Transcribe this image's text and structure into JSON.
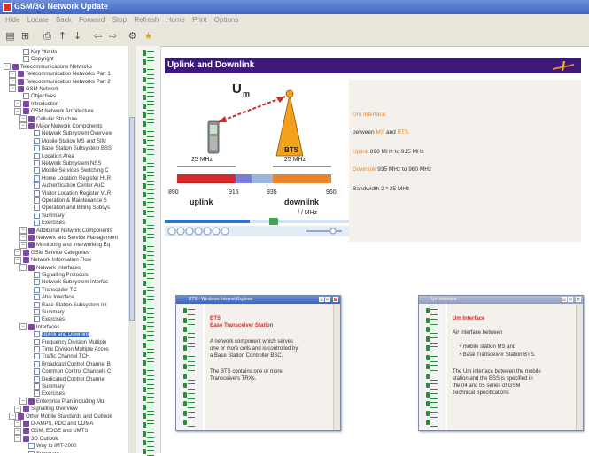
{
  "window": {
    "title": "GSM/3G Network Update"
  },
  "menubar": {
    "items": [
      "Hide",
      "Locate",
      "Back",
      "Forward",
      "Stop",
      "Refresh",
      "Home",
      "Print",
      "Options"
    ]
  },
  "tree": {
    "items": [
      {
        "label": "Key Words",
        "depth": 3,
        "icon": "page"
      },
      {
        "label": "Copyright",
        "depth": 3,
        "icon": "page"
      },
      {
        "label": "Telecommunications Networks",
        "depth": 1,
        "icon": "book"
      },
      {
        "label": "Telecommunication Networks Part 1",
        "depth": 2,
        "icon": "book"
      },
      {
        "label": "Telecommunication Networks Part 2",
        "depth": 2,
        "icon": "book"
      },
      {
        "label": "GSM Network",
        "depth": 2,
        "icon": "book"
      },
      {
        "label": "Objectives",
        "depth": 3,
        "icon": "page"
      },
      {
        "label": "Introduction",
        "depth": 3,
        "icon": "book"
      },
      {
        "label": "GSM Network Architecture",
        "depth": 3,
        "icon": "book"
      },
      {
        "label": "Cellular Structure",
        "depth": 4,
        "icon": "book"
      },
      {
        "label": "Major Network Components",
        "depth": 4,
        "icon": "book"
      },
      {
        "label": "Network Subsystem Overview",
        "depth": 5,
        "icon": "page"
      },
      {
        "label": "Mobile Station MS and SIM",
        "depth": 5,
        "icon": "page"
      },
      {
        "label": "Base Station Subsystem BSS",
        "depth": 5,
        "icon": "page"
      },
      {
        "label": "Location Area",
        "depth": 5,
        "icon": "page"
      },
      {
        "label": "Network Subsystem NSS",
        "depth": 5,
        "icon": "page"
      },
      {
        "label": "Mobile Services Switching C",
        "depth": 5,
        "icon": "page"
      },
      {
        "label": "Home Location Register HLR",
        "depth": 5,
        "icon": "page"
      },
      {
        "label": "Authentication Center AuC",
        "depth": 5,
        "icon": "page"
      },
      {
        "label": "Visitor Location Register VLR",
        "depth": 5,
        "icon": "page"
      },
      {
        "label": "Operation & Maintenance S",
        "depth": 5,
        "icon": "page"
      },
      {
        "label": "Operation and Billing Subsys",
        "depth": 5,
        "icon": "page"
      },
      {
        "label": "Summary",
        "depth": 5,
        "icon": "page"
      },
      {
        "label": "Exercises",
        "depth": 5,
        "icon": "page"
      },
      {
        "label": "Additional Network Components",
        "depth": 4,
        "icon": "book"
      },
      {
        "label": "Network and Service Management",
        "depth": 4,
        "icon": "book"
      },
      {
        "label": "Monitoring and Interworking Eq",
        "depth": 4,
        "icon": "book"
      },
      {
        "label": "GSM Service Categories",
        "depth": 3,
        "icon": "book"
      },
      {
        "label": "Network Information Flow",
        "depth": 3,
        "icon": "book"
      },
      {
        "label": "Network Interfaces",
        "depth": 4,
        "icon": "book"
      },
      {
        "label": "Signalling Protocols",
        "depth": 5,
        "icon": "page"
      },
      {
        "label": "Network Subsystem Interfac",
        "depth": 5,
        "icon": "page"
      },
      {
        "label": "Transcoder TC",
        "depth": 5,
        "icon": "page"
      },
      {
        "label": "Abis Interface",
        "depth": 5,
        "icon": "page"
      },
      {
        "label": "Base Station Subsystem Int",
        "depth": 5,
        "icon": "page"
      },
      {
        "label": "Summary",
        "depth": 5,
        "icon": "page"
      },
      {
        "label": "Exercises",
        "depth": 5,
        "icon": "page"
      },
      {
        "label": "Interfaces",
        "depth": 4,
        "icon": "book"
      },
      {
        "label": "Uplink and Downlink",
        "depth": 5,
        "icon": "page",
        "selected": true
      },
      {
        "label": "Frequency Division Multiple",
        "depth": 5,
        "icon": "page"
      },
      {
        "label": "Time Division Multiple Acces",
        "depth": 5,
        "icon": "page"
      },
      {
        "label": "Traffic Channel TCH",
        "depth": 5,
        "icon": "page"
      },
      {
        "label": "Broadcast Control Channel B",
        "depth": 5,
        "icon": "page"
      },
      {
        "label": "Common Control Channels C",
        "depth": 5,
        "icon": "page"
      },
      {
        "label": "Dedicated Control Channel",
        "depth": 5,
        "icon": "page"
      },
      {
        "label": "Summary",
        "depth": 5,
        "icon": "page"
      },
      {
        "label": "Exercises",
        "depth": 5,
        "icon": "page"
      },
      {
        "label": "Enterprise Plan including Mo",
        "depth": 4,
        "icon": "book"
      },
      {
        "label": "Signalling Overview",
        "depth": 3,
        "icon": "book"
      },
      {
        "label": "Other Mobile Standards and Outlook",
        "depth": 2,
        "icon": "book"
      },
      {
        "label": "D-AMPS, PDC and CDMA",
        "depth": 3,
        "icon": "book"
      },
      {
        "label": "GSM, EDGE and UMTS",
        "depth": 3,
        "icon": "book"
      },
      {
        "label": "3G Outlook",
        "depth": 3,
        "icon": "book"
      },
      {
        "label": "Way to IMT-2000",
        "depth": 4,
        "icon": "page"
      },
      {
        "label": "Summary",
        "depth": 4,
        "icon": "page"
      }
    ]
  },
  "page": {
    "banner_title": "Uplink and Downlink",
    "diagram": {
      "um_main": "U",
      "um_sub": "m",
      "bts_label": "BTS",
      "bw_left": "25 MHz",
      "bw_right": "25 MHz",
      "ticks": [
        "890",
        "915",
        "935",
        "960"
      ],
      "uplink": "uplink",
      "downlink": "downlink",
      "axis_unit": "f / MHz"
    },
    "text_panel": {
      "heading": "Um Interface",
      "between_prefix": "between",
      "between_ms": "MS",
      "between_and": "and",
      "between_bts": "BTS",
      "uplink_label": "Uplink",
      "uplink_range": "890 MHz to 915 MHz",
      "downlink_label": "Downlink",
      "downlink_range": "935 MHz to 960 MHz",
      "bandwidth": "Bandwidth 2 * 25 MHz"
    }
  },
  "popup_bts": {
    "title": "BTS - Windows Internet Explorer",
    "heading1": "BTS",
    "heading2": "Base Transceiver Station",
    "para1_lines": [
      "A network component which serves",
      "one or more cells and is controlled by",
      "a Base Station Controller BSC."
    ],
    "para2_lines": [
      "The BTS contains one or more",
      "Transceivers TRXs."
    ]
  },
  "popup_um": {
    "title": "Um Interface",
    "heading": "Um Interface",
    "intro": "Air interface between",
    "bullets": [
      "mobile station MS and",
      "Base Transceiver Station BTS."
    ],
    "para_lines": [
      "The Um interface between the mobile",
      "station and the BSS is specified in",
      "the 04 and 05 series of GSM",
      "Technical Specifications"
    ]
  },
  "colors": {
    "banner": "#3d1a78",
    "link": "#e8852c",
    "uplink": "#d42a2a",
    "downlink": "#e8832a",
    "guard": "#7b7bd9",
    "popup_heading": "#d0302c"
  }
}
